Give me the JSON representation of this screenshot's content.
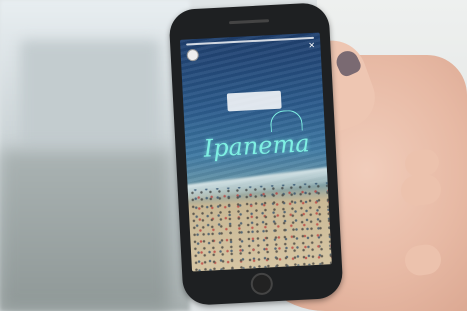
{
  "screen": {
    "username": "",
    "time": "",
    "location_sticker": "",
    "sticker_text": "Ipanema",
    "caption": ""
  },
  "icons": {
    "close": "close-icon",
    "home": "home-button"
  }
}
